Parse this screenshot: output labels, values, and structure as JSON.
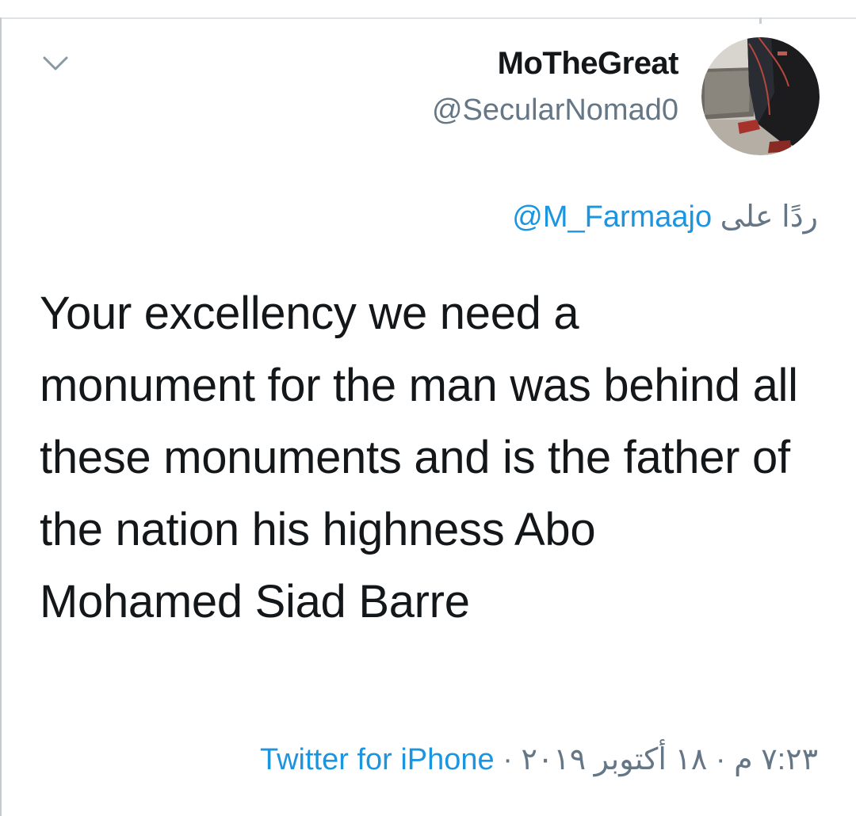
{
  "tweet": {
    "author": {
      "display_name": "MoTheGreat",
      "handle": "@SecularNomad0"
    },
    "reply": {
      "prefix": "ردًا على",
      "mention": "M_Farmaajo@"
    },
    "text": "Your excellency we need a monument for the man was behind all these monuments and is the father of the nation his highness Abo Mohamed Siad Barre",
    "timestamp": "٧:٢٣ م · ١٨ أكتوبر ٢٠١٩",
    "separator": "·",
    "source": "Twitter for iPhone"
  },
  "icons": {
    "collapse": "chevron-down-icon"
  },
  "colors": {
    "link": "#1b95e0",
    "secondary_text": "#657786",
    "primary_text": "#14171a"
  }
}
